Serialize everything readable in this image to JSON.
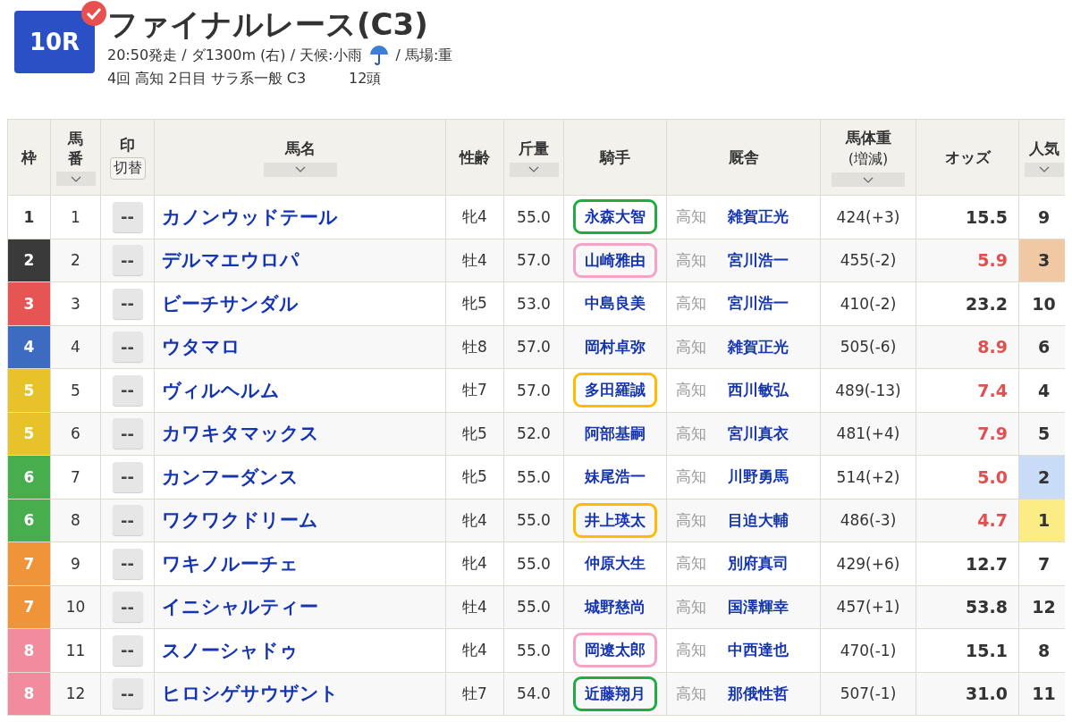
{
  "race": {
    "number": "10R",
    "checked": true,
    "title": "ファイナルレース(C3)",
    "info": "20:50発走 / ダ1300m (右) / 天候:小雨",
    "track": "/ 馬場:重",
    "meeting": "4回 高知 2日目 サラ系一般 C3",
    "runners": "12頭"
  },
  "columns": [
    {
      "label": "枠",
      "kind": "plain",
      "sortable": false
    },
    {
      "label": "馬番",
      "kind": "vertical",
      "sortable": true
    },
    {
      "label": "印",
      "kind": "toggle",
      "button": "切替",
      "sortable": false
    },
    {
      "label": "馬名",
      "kind": "plain",
      "sortable": true
    },
    {
      "label": "性齢",
      "kind": "plain",
      "sortable": false
    },
    {
      "label": "斤量",
      "kind": "plain",
      "sortable": true
    },
    {
      "label": "騎手",
      "kind": "plain",
      "sortable": false
    },
    {
      "label": "厩舎",
      "kind": "plain",
      "sortable": false
    },
    {
      "label": "馬体重",
      "kind": "sub",
      "sub": "(増減)",
      "sortable": true
    },
    {
      "label": "オッズ",
      "kind": "plain",
      "sortable": false
    },
    {
      "label": "人気",
      "kind": "plain",
      "sortable": true
    }
  ],
  "rows": [
    {
      "frame": {
        "text": "1",
        "color": "#ffffff"
      },
      "number": "1",
      "mark": "--",
      "name": "カノンウッドテール",
      "sex_age": "牝4",
      "weight": "55.0",
      "jockey": {
        "name": "永森大智",
        "color": "#22aa44"
      },
      "region": "高知",
      "trainer": "雑賀正光",
      "body": "424(+3)",
      "odds": "15.5",
      "odds_hot": false,
      "popularity": {
        "text": "9"
      }
    },
    {
      "frame": {
        "text": "2",
        "color": "#3a3a3a"
      },
      "number": "2",
      "mark": "--",
      "name": "デルマエウロパ",
      "sex_age": "牡4",
      "weight": "57.0",
      "jockey": {
        "name": "山崎雅由",
        "color": "#f4a3c6"
      },
      "region": "高知",
      "trainer": "宮川浩一",
      "body": "455(-2)",
      "odds": "5.9",
      "odds_hot": true,
      "popularity": {
        "text": "3",
        "color": "#f0c9a4"
      }
    },
    {
      "frame": {
        "text": "3",
        "color": "#e65454"
      },
      "number": "3",
      "mark": "--",
      "name": "ビーチサンダル",
      "sex_age": "牝5",
      "weight": "53.0",
      "jockey": {
        "name": "中島良美"
      },
      "region": "高知",
      "trainer": "宮川浩一",
      "body": "410(-2)",
      "odds": "23.2",
      "odds_hot": false,
      "popularity": {
        "text": "10"
      }
    },
    {
      "frame": {
        "text": "4",
        "color": "#3d6bc2"
      },
      "number": "4",
      "mark": "--",
      "name": "ウタマロ",
      "sex_age": "牡8",
      "weight": "57.0",
      "jockey": {
        "name": "岡村卓弥"
      },
      "region": "高知",
      "trainer": "雑賀正光",
      "body": "505(-6)",
      "odds": "8.9",
      "odds_hot": true,
      "popularity": {
        "text": "6"
      }
    },
    {
      "frame": {
        "text": "5",
        "color": "#e8c22a"
      },
      "number": "5",
      "mark": "--",
      "name": "ヴィルヘルム",
      "sex_age": "牡7",
      "weight": "57.0",
      "jockey": {
        "name": "多田羅誠",
        "color": "#ffbb00"
      },
      "region": "高知",
      "trainer": "西川敏弘",
      "body": "489(-13)",
      "odds": "7.4",
      "odds_hot": true,
      "popularity": {
        "text": "4"
      }
    },
    {
      "frame": {
        "text": "5",
        "color": "#e8c22a"
      },
      "number": "6",
      "mark": "--",
      "name": "カワキタマックス",
      "sex_age": "牝5",
      "weight": "52.0",
      "jockey": {
        "name": "阿部基嗣"
      },
      "region": "高知",
      "trainer": "宮川真衣",
      "body": "481(+4)",
      "odds": "7.9",
      "odds_hot": true,
      "popularity": {
        "text": "5"
      }
    },
    {
      "frame": {
        "text": "6",
        "color": "#48ad4c"
      },
      "number": "7",
      "mark": "--",
      "name": "カンフーダンス",
      "sex_age": "牝5",
      "weight": "55.0",
      "jockey": {
        "name": "妹尾浩一"
      },
      "region": "高知",
      "trainer": "川野勇馬",
      "body": "514(+2)",
      "odds": "5.0",
      "odds_hot": true,
      "popularity": {
        "text": "2",
        "color": "#c9dcf7"
      }
    },
    {
      "frame": {
        "text": "6",
        "color": "#48ad4c"
      },
      "number": "8",
      "mark": "--",
      "name": "ワクワクドリーム",
      "sex_age": "牝4",
      "weight": "55.0",
      "jockey": {
        "name": "井上瑛太",
        "color": "#ffbb00"
      },
      "region": "高知",
      "trainer": "目迫大輔",
      "body": "486(-3)",
      "odds": "4.7",
      "odds_hot": true,
      "popularity": {
        "text": "1",
        "color": "#fbec85"
      }
    },
    {
      "frame": {
        "text": "7",
        "color": "#ef9438"
      },
      "number": "9",
      "mark": "--",
      "name": "ワキノルーチェ",
      "sex_age": "牝4",
      "weight": "55.0",
      "jockey": {
        "name": "仲原大生"
      },
      "region": "高知",
      "trainer": "別府真司",
      "body": "429(+6)",
      "odds": "12.7",
      "odds_hot": false,
      "popularity": {
        "text": "7"
      }
    },
    {
      "frame": {
        "text": "7",
        "color": "#ef9438"
      },
      "number": "10",
      "mark": "--",
      "name": "イニシャルティー",
      "sex_age": "牡4",
      "weight": "55.0",
      "jockey": {
        "name": "城野慈尚"
      },
      "region": "高知",
      "trainer": "国澤輝幸",
      "body": "457(+1)",
      "odds": "53.8",
      "odds_hot": false,
      "popularity": {
        "text": "12"
      }
    },
    {
      "frame": {
        "text": "8",
        "color": "#f08c9e"
      },
      "number": "11",
      "mark": "--",
      "name": "スノーシャドゥ",
      "sex_age": "牝4",
      "weight": "55.0",
      "jockey": {
        "name": "岡遼太郎",
        "color": "#f4a3c6"
      },
      "region": "高知",
      "trainer": "中西達也",
      "body": "470(-1)",
      "odds": "15.1",
      "odds_hot": false,
      "popularity": {
        "text": "8"
      }
    },
    {
      "frame": {
        "text": "8",
        "color": "#f08c9e"
      },
      "number": "12",
      "mark": "--",
      "name": "ヒロシゲサウザント",
      "sex_age": "牡7",
      "weight": "54.0",
      "jockey": {
        "name": "近藤翔月",
        "color": "#22aa44"
      },
      "region": "高知",
      "trainer": "那俄性哲",
      "body": "507(-1)",
      "odds": "31.0",
      "odds_hot": false,
      "popularity": {
        "text": "11"
      }
    }
  ]
}
